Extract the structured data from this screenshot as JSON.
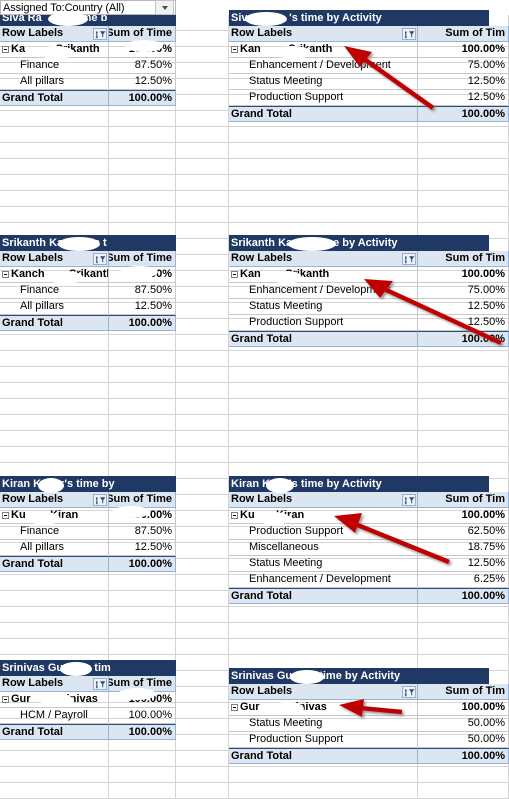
{
  "filter": {
    "label": "Assigned To:Country  (All)",
    "dropdown_icon": "chevron-down-icon"
  },
  "columns": {
    "row_labels": "Row Labels",
    "sum_of_time": "Sum of Time",
    "sum_of_time_clipped": "Sum of Tim",
    "grand_total": "Grand Total",
    "filter_icon": "sort-filter-icon"
  },
  "blocks": [
    {
      "id": "siva",
      "left": {
        "title": "Siva Ra     a's  time b",
        "header": {
          "labels": "Row Labels",
          "value": "Sum of Time"
        },
        "person": {
          "label": "Ka        , Srikanth",
          "value": "100.00%"
        },
        "rows": [
          {
            "label": "Finance",
            "value": "87.50%"
          },
          {
            "label": "All pillars",
            "value": "12.50%"
          }
        ],
        "total": {
          "label": "Grand Total",
          "value": "100.00%"
        }
      },
      "right": {
        "title": "Siva Ra      's time by Activity",
        "header": {
          "labels": "Row Labels",
          "value": "Sum of Tim"
        },
        "person": {
          "label": "Kan       , Srikanth",
          "value": "100.00%"
        },
        "rows": [
          {
            "label": "Enhancement / Development",
            "value": "75.00%"
          },
          {
            "label": "Status Meeting",
            "value": "12.50%"
          },
          {
            "label": "Production Support",
            "value": "12.50%"
          }
        ],
        "total": {
          "label": "Grand Total",
          "value": "100.00%"
        }
      }
    },
    {
      "id": "srikanth",
      "left": {
        "title": "Srikanth Kan     a's  t",
        "header": {
          "labels": "Row Labels",
          "value": "Sum of Time"
        },
        "person": {
          "label": "Kanch      , Srikanth",
          "value": "100.00%"
        },
        "rows": [
          {
            "label": "Finance",
            "value": "87.50%"
          },
          {
            "label": "All pillars",
            "value": "12.50%"
          }
        ],
        "total": {
          "label": "Grand Total",
          "value": "100.00%"
        }
      },
      "right": {
        "title": "Srikanth Ka        time by Activity",
        "header": {
          "labels": "Row Labels",
          "value": "Sum of Tim"
        },
        "person": {
          "label": "Kan      , Srikanth",
          "value": "100.00%"
        },
        "rows": [
          {
            "label": "Enhancement / Development",
            "value": "75.00%"
          },
          {
            "label": "Status Meeting",
            "value": "12.50%"
          },
          {
            "label": "Production Support",
            "value": "12.50%"
          }
        ],
        "total": {
          "label": "Grand Total",
          "value": "100.00%"
        }
      }
    },
    {
      "id": "kiran",
      "left": {
        "title": "Kiran Ku    r's time by",
        "header": {
          "labels": "Row Labels",
          "value": "Sum of Time"
        },
        "person": {
          "label": "Ku      , Kiran",
          "value": "100.00%"
        },
        "rows": [
          {
            "label": "Finance",
            "value": "87.50%"
          },
          {
            "label": "All pillars",
            "value": "12.50%"
          }
        ],
        "total": {
          "label": "Grand Total",
          "value": "100.00%"
        }
      },
      "right": {
        "title": "Kiran Ku    's time by Activity",
        "header": {
          "labels": "Row Labels",
          "value": "Sum of Tim"
        },
        "person": {
          "label": "Ku     , Kiran",
          "value": "100.00%"
        },
        "rows": [
          {
            "label": "Production Support",
            "value": "62.50%"
          },
          {
            "label": "Miscellaneous",
            "value": "18.75%"
          },
          {
            "label": "Status Meeting",
            "value": "12.50%"
          },
          {
            "label": "Enhancement / Development",
            "value": "6.25%"
          }
        ],
        "total": {
          "label": "Grand Total",
          "value": "100.00%"
        }
      }
    },
    {
      "id": "srinivas",
      "left": {
        "title": "Srinivas Gun     s tim",
        "header": {
          "labels": "Row Labels",
          "value": "Sum of Time"
        },
        "person": {
          "label": "Gur      , Srinivas",
          "value": "100.00%"
        },
        "rows": [
          {
            "label": "HCM / Payroll",
            "value": "100.00%"
          }
        ],
        "total": {
          "label": "Grand Total",
          "value": "100.00%"
        }
      },
      "right": {
        "title": "Srinivas Gu     's time by Activity",
        "header": {
          "labels": "Row Labels",
          "value": "Sum of Tim"
        },
        "person": {
          "label": "Gur      , Srinivas",
          "value": "100.00%"
        },
        "rows": [
          {
            "label": "Status Meeting",
            "value": "50.00%"
          },
          {
            "label": "Production Support",
            "value": "50.00%"
          }
        ],
        "total": {
          "label": "Grand Total",
          "value": "100.00%"
        }
      }
    }
  ],
  "colors": {
    "header_navy": "#1F3864",
    "band_blue": "#DCE6F1",
    "grid_line": "#D4D4D4",
    "arrow_red": "#C00000"
  }
}
